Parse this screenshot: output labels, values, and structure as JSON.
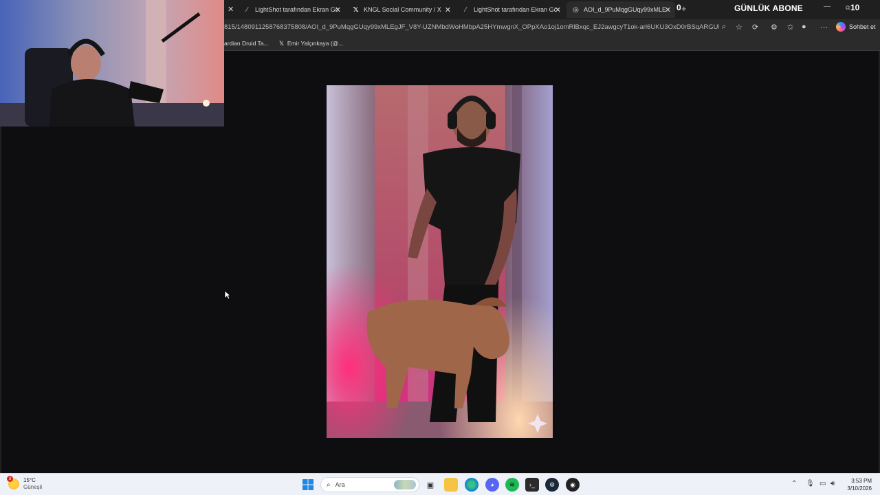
{
  "browser": {
    "tabs": [
      {
        "label": "LightShot tarafından Ekran Görüntü",
        "icon": "feather-icon",
        "active": false
      },
      {
        "label": "KNGL Social Community / X",
        "icon": "x-logo-icon",
        "active": false
      },
      {
        "label": "LightShot tarafından Ekran Görüntü",
        "icon": "feather-icon",
        "active": false
      },
      {
        "label": "AOI_d_9PuMqgGUqy99xMLEgJF_V",
        "icon": "globe-icon",
        "active": true
      }
    ],
    "address_url": "815/1480911258768375808/AOI_d_9PuMqgGUqy99xMLEgJF_V8Y-UZNMbdWoHMbpA25HYmwgnX_OPpXAo1oj1omRlBxqc_EJ2awgcyT1ok-arl6UKU3OxD0rBSqARGUI_y8EN...",
    "copilot_label": "Sohbet et",
    "bookmarks": [
      {
        "label": "ardian Druid Ta..."
      },
      {
        "label": "Emir Yalçınkaya (@..."
      }
    ]
  },
  "stream_overlay": {
    "left_counter": "0",
    "title": "GÜNLÜK ABONE",
    "right_counter": "10"
  },
  "taskbar": {
    "weather_temp": "15°C",
    "weather_desc": "Güneşli",
    "weather_badge": "3",
    "search_placeholder": "Ara",
    "time": "3:53 PM",
    "date": "3/10/2026"
  }
}
